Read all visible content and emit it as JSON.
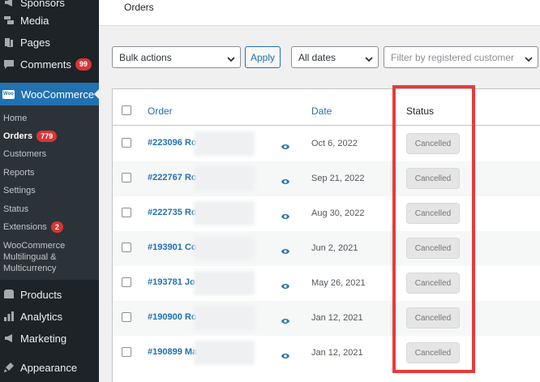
{
  "sidebar": {
    "top_items": [
      {
        "label": "Sponsors",
        "icon": "megaphone-icon"
      },
      {
        "label": "Media",
        "icon": "media-icon"
      },
      {
        "label": "Pages",
        "icon": "pages-icon"
      },
      {
        "label": "Comments",
        "icon": "comment-icon",
        "badge": "99"
      }
    ],
    "woocommerce": {
      "label": "WooCommerce",
      "logo_text": "Woo"
    },
    "submenu": [
      {
        "label": "Home"
      },
      {
        "label": "Orders",
        "badge": "779"
      },
      {
        "label": "Customers"
      },
      {
        "label": "Reports"
      },
      {
        "label": "Settings"
      },
      {
        "label": "Status"
      },
      {
        "label": "Extensions",
        "badge": "2"
      },
      {
        "label": "WooCommerce Multilingual & Multicurrency"
      }
    ],
    "bottom_items": [
      {
        "label": "Products",
        "icon": "box-icon"
      },
      {
        "label": "Analytics",
        "icon": "bar-chart-icon"
      },
      {
        "label": "Marketing",
        "icon": "megaphone-icon"
      },
      {
        "label": "Appearance",
        "icon": "brush-icon"
      }
    ]
  },
  "header": {
    "title": "Orders"
  },
  "filters": {
    "bulk_actions": "Bulk actions",
    "apply": "Apply",
    "dates": "All dates",
    "customer_placeholder": "Filter by registered customer"
  },
  "table": {
    "columns": {
      "order": "Order",
      "date": "Date",
      "status": "Status"
    },
    "rows": [
      {
        "order": "#223096 Ro",
        "date": "Oct 6, 2022",
        "status": "Cancelled"
      },
      {
        "order": "#222767 Ro",
        "date": "Sep 21, 2022",
        "status": "Cancelled"
      },
      {
        "order": "#222735 Ro",
        "date": "Aug 30, 2022",
        "status": "Cancelled"
      },
      {
        "order": "#193901 Co",
        "date": "Jun 2, 2021",
        "status": "Cancelled"
      },
      {
        "order": "#193781 Jo",
        "date": "May 26, 2021",
        "status": "Cancelled"
      },
      {
        "order": "#190900 Ro",
        "date": "Jan 12, 2021",
        "status": "Cancelled"
      },
      {
        "order": "#190899 Ma",
        "date": "Jan 12, 2021",
        "status": "Cancelled"
      }
    ]
  },
  "colors": {
    "accent": "#2271b1",
    "sidebar": "#1d2327",
    "highlight": "#e83a3a",
    "badge": "#d63638"
  }
}
